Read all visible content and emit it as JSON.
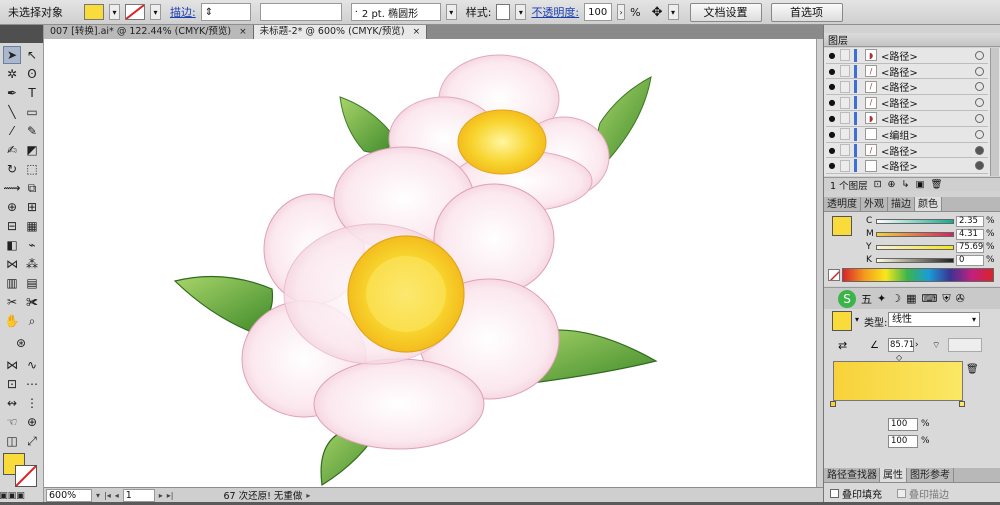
{
  "control_bar": {
    "selection": "未选择对象",
    "fill_color": "#f9dc3c",
    "stroke_label": "描边:",
    "brush_label": "2 pt. 椭圆形",
    "style_label": "样式:",
    "opacity_label": "不透明度:",
    "opacity_value": "100",
    "opacity_unit": "%",
    "doc_setup": "文档设置",
    "preferences": "首选项"
  },
  "tabs": [
    {
      "label": "007 [转换].ai* @ 122.44% (CMYK/预览)",
      "close": "×"
    },
    {
      "label": "未标题-2* @ 600% (CMYK/预览)",
      "close": "×"
    }
  ],
  "status": {
    "zoom": "600%",
    "page": "1",
    "message": "67 次还原! 无重做"
  },
  "layers_panel": {
    "title": "图层",
    "rows": [
      {
        "name": "<路径>",
        "thumb": "◗",
        "target": "empty"
      },
      {
        "name": "<路径>",
        "thumb": "/",
        "target": "empty"
      },
      {
        "name": "<路径>",
        "thumb": "/",
        "target": "empty"
      },
      {
        "name": "<路径>",
        "thumb": "/",
        "target": "empty"
      },
      {
        "name": "<路径>",
        "thumb": "◗",
        "target": "empty"
      },
      {
        "name": "<编组>",
        "thumb": "",
        "target": "empty"
      },
      {
        "name": "<路径>",
        "thumb": "/",
        "target": "filled"
      },
      {
        "name": "<路径>",
        "thumb": "",
        "target": "filled"
      }
    ],
    "footer": "1 个图层"
  },
  "color_panel": {
    "tabs": [
      "透明度",
      "外观",
      "描边",
      "颜色"
    ],
    "swatch": "#f9dc3c",
    "channels": [
      {
        "label": "C",
        "value": "2.35",
        "from": "#ffffff",
        "to": "#17a890"
      },
      {
        "label": "M",
        "value": "4.31",
        "from": "#f2d33a",
        "to": "#d6205f"
      },
      {
        "label": "Y",
        "value": "75.69",
        "from": "#f6f0e0",
        "to": "#f5e51a"
      },
      {
        "label": "K",
        "value": "0",
        "from": "#fffde0",
        "to": "#222222"
      }
    ],
    "unit": "%"
  },
  "gradient_panel": {
    "type_label": "类型:",
    "type_value": "线性",
    "angle_value": "85.71",
    "ramp_from": "#f8d23a",
    "ramp_to": "#fae864",
    "opacity_value": "100",
    "position_value": "100",
    "opacity_unit": "%",
    "bottom_tab1": "路径查找器",
    "bottom_tab2": "属性",
    "bottom_tab3": "图形参考",
    "checkbox1": "叠印填充",
    "checkbox2": "叠印描边"
  },
  "colors": {
    "accent": "#f9dc3c",
    "layer_bar": "#3d6fd6",
    "leaf": "#5aa63a",
    "petal": "#f4d7e1",
    "stamen": "#f6cf26"
  }
}
